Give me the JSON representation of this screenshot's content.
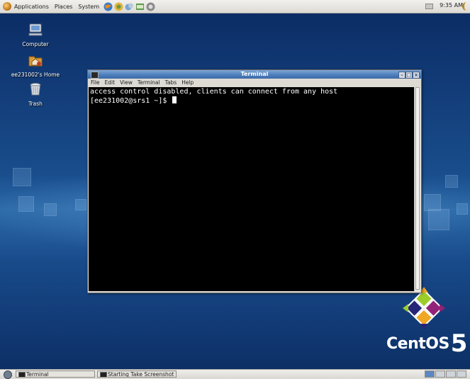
{
  "top_panel": {
    "menus": [
      "Applications",
      "Places",
      "System"
    ],
    "clock": "9:35 AM"
  },
  "desktop": {
    "icons": [
      {
        "label": "Computer"
      },
      {
        "label": "ee231002's Home"
      },
      {
        "label": "Trash"
      }
    ]
  },
  "terminal": {
    "title": "Terminal",
    "menu": [
      "File",
      "Edit",
      "View",
      "Terminal",
      "Tabs",
      "Help"
    ],
    "lines": [
      "access control disabled, clients can connect from any host",
      "[ee231002@srs1 ~]$ "
    ]
  },
  "branding": {
    "word": "CentOS",
    "version": "5"
  },
  "taskbar": {
    "tasks": [
      {
        "label": "Terminal"
      },
      {
        "label": "Starting Take Screenshot"
      }
    ]
  },
  "colors": {
    "desktop": "#13457c",
    "titlebar": "#4b7cba",
    "terminal_bg": "#000000",
    "terminal_fg": "#ffffff"
  }
}
